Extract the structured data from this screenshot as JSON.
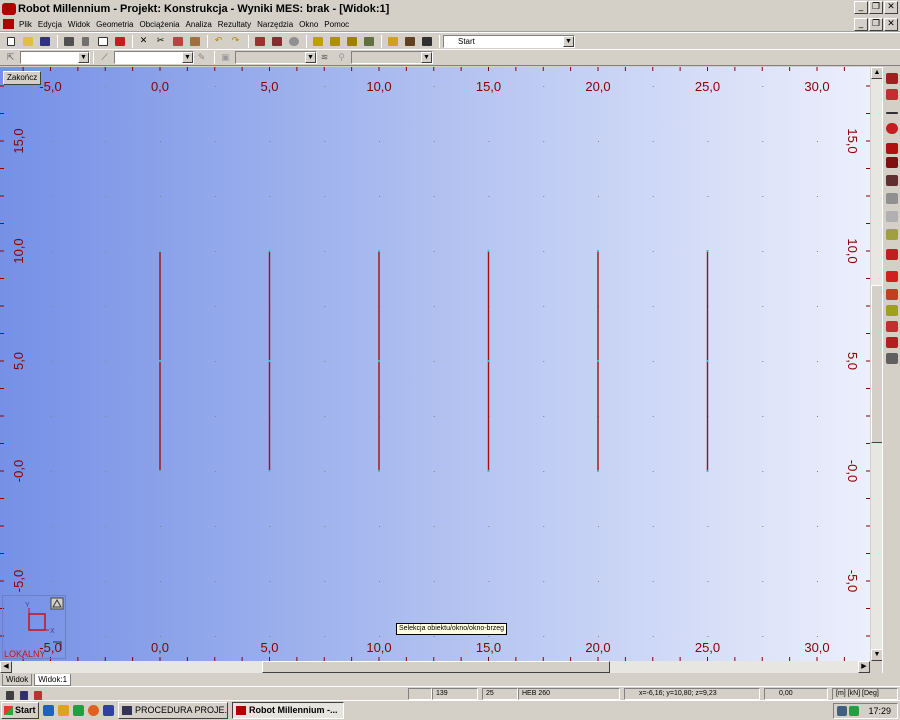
{
  "window": {
    "title": "Robot Millennium - Projekt: Konstrukcja - Wyniki MES: brak - [Widok:1]",
    "controls": [
      "_",
      "❐",
      "✕"
    ],
    "doc_controls": [
      "_",
      "❐",
      "✕"
    ]
  },
  "menu": [
    "Plik",
    "Edycja",
    "Widok",
    "Geometria",
    "Obciążenia",
    "Analiza",
    "Rezultaty",
    "Narzędzia",
    "Okno",
    "Pomoc"
  ],
  "toolbar": {
    "layout_combo": "Start"
  },
  "viewport": {
    "finish_button": "Zakończ",
    "tooltip": "Selekcja obiektu/okno/okno-brzeg",
    "local_label": "LOKALNY",
    "axis_x_label": "X",
    "axis_y_label": "Y",
    "x_ticks_top": [
      "-5,0",
      "0,0",
      "5,0",
      "10,0",
      "15,0",
      "20,0",
      "25,0",
      "30,0"
    ],
    "x_ticks_bottom": [
      "-5,0",
      "0,0",
      "5,0",
      "10,0",
      "15,0",
      "20,0",
      "25,0",
      "30,0"
    ],
    "z_ticks_left": [
      "15,0",
      "10,0",
      "5,0",
      "-0,0",
      "-5,0"
    ],
    "z_ticks_right": [
      "15,0",
      "10,0",
      "5,0",
      "-0,0",
      "-5,0"
    ],
    "colors": {
      "gradient_left": "#7590e6",
      "gradient_right": "#eceffc",
      "tick_text": "#8b0000",
      "bar": "#a01010",
      "grid_dot": "#808080"
    }
  },
  "structure": {
    "bars_x_positions_m": [
      0,
      5,
      10,
      15,
      20,
      25
    ],
    "bar_z_range_m": [
      0,
      10
    ]
  },
  "tabs": [
    "Widok",
    "Widok:1"
  ],
  "status": {
    "field1": "139",
    "field2": "25",
    "section": "HEB 260",
    "coords": "x=-6,16; y=10,80; z=9,23",
    "value": "0,00",
    "units": "[m] [kN] [Deg]"
  },
  "taskbar": {
    "start": "Start",
    "tasks": [
      "PROCEDURA PROJE...",
      "Robot Millennium -..."
    ],
    "clock": "17:29"
  }
}
